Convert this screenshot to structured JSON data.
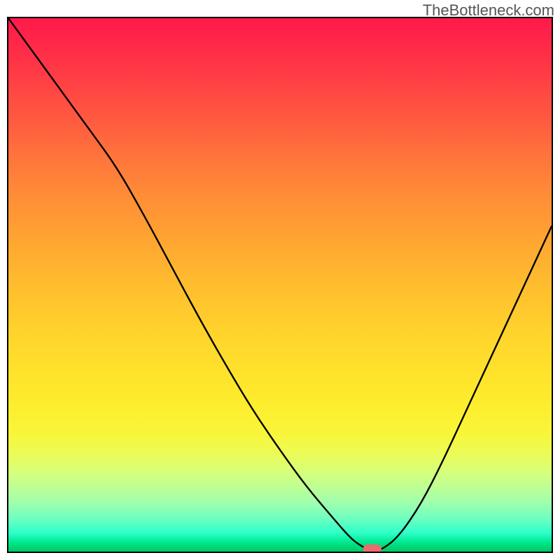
{
  "watermark": "TheBottleneck.com",
  "chart_data": {
    "type": "line",
    "title": "",
    "xlabel": "",
    "ylabel": "",
    "xlim": [
      0,
      100
    ],
    "ylim": [
      0,
      100
    ],
    "background": "vertical red→yellow→green gradient (bottleneck heatmap)",
    "curve_note": "V-shaped bottleneck curve with minimum near x≈67; small red pill marker at the minimum",
    "series": [
      {
        "name": "bottleneck-curve",
        "x": [
          0,
          5,
          10,
          15,
          20,
          25,
          30,
          35,
          40,
          45,
          50,
          55,
          60,
          63,
          65,
          67,
          69,
          72,
          76,
          80,
          85,
          90,
          95,
          100
        ],
        "y": [
          100,
          93,
          86,
          79,
          72,
          63,
          53.5,
          44,
          35,
          26.5,
          19,
          12,
          6,
          2.5,
          1,
          0,
          0.5,
          3,
          9,
          17,
          28,
          39,
          50,
          61
        ]
      }
    ],
    "marker": {
      "x": 67,
      "y": 0,
      "color": "#ef6a6f",
      "shape": "rounded-rect"
    }
  }
}
